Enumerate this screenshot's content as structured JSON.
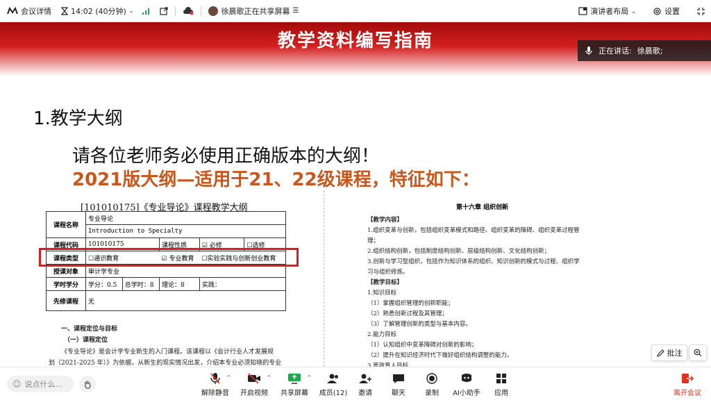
{
  "topbar": {
    "meeting_details": "会议详情",
    "time": "14:02 (40分钟)",
    "sharer_status": "徐晨歌正在共享屏幕",
    "presenter_layout": "演讲者布局",
    "settings": "设置"
  },
  "slide": {
    "banner_title": "教学资料编写指南",
    "speaking_label": "正在讲话:",
    "speaking_name": "徐晨歌;",
    "heading": "1.教学大纲",
    "line1": "请各位老师务必使用正确版本的大纲！",
    "line2": "2021版大纲—适用于21、22级课程，特征如下：",
    "doc_left": {
      "title": "[101010175]《专业导论》课程教学大纲",
      "rows": [
        {
          "label": "课程名称",
          "value": "专业导论"
        },
        {
          "label": "",
          "value": "Introduction to Specialty"
        },
        {
          "label": "课程代码",
          "value": "101010175",
          "prop_label": "课程性质",
          "opt1": "☑ 必修",
          "opt2": "☐选修"
        },
        {
          "label": "课程类型",
          "opt1": "☐通识教育",
          "opt2": "☑ 专业教育",
          "opt3": "☐实验实践与创新创业教育"
        },
        {
          "label": "授课对象",
          "value": "审计学专业"
        },
        {
          "label": "学时学分",
          "credit": "学分：0.5",
          "hours": "总学时：8",
          "theory": "理论：8",
          "practice": "实践："
        },
        {
          "label": "先修课程",
          "value": "无"
        }
      ],
      "sec1": "一、课程定位与目标",
      "sec1a": "（一）课程定位",
      "para1": "《专业导论》是会计学专业新生的入门课程。该课程以《会计行业人才发展规",
      "para2": "划（2021-2025 年）》为依据，从新生的现实情况出发，介绍本专业必须知晓的专业"
    },
    "doc_right": {
      "chapter": "第十六章 组织创新",
      "lines": [
        "【教学内容】",
        "1.组织变革与创新，包括组织变革模式和路径、组织变革的障碍、组织变革过程管",
        "理；",
        "2.组织结构创新，包括制度结构创新、层级结构创新、文化结构创新；",
        "3.创新与学习型组织，包括作为知识体系的组织、知识创新的模式与过程、组织学",
        "习与组织修炼。",
        "【教学目标】",
        "1.知识目标",
        "（1）掌握组织管理的创新职能；",
        "（2）熟悉创新过程及其管理；",
        "（3）了解管理创新的类型与基本内容。",
        "2.能力目标",
        "（1）认知组织中变革障碍对创新的影响；",
        "（2）提升在知识经济时代下做好组织结构调整的能力。",
        "3.思政育人目标"
      ]
    },
    "annotate_label": "批注"
  },
  "bottombar": {
    "chat_placeholder": "说点什么...",
    "controls": {
      "unmute": "解除静音",
      "start_video": "开启视频",
      "share_screen": "共享屏幕",
      "members": "成员(12)",
      "invite": "邀请",
      "chat": "聊天",
      "record": "录制",
      "ai_assistant": "AI小助手",
      "apps": "应用",
      "leave": "离开会议"
    }
  },
  "colors": {
    "banner_red": "#c81616",
    "highlight_orange": "#c8581e",
    "leave_red": "#e0301e",
    "box_red": "#e31a1a"
  }
}
